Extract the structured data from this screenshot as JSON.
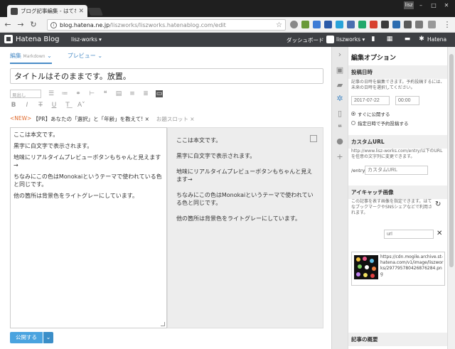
{
  "browser": {
    "tab_title": "ブログ記事編集 - はてなブロ",
    "url_host": "blog.hatena.ne.jp",
    "url_path": "/liszworks/liszworks.hatenablog.com/edit",
    "user_chip": "lisz"
  },
  "header": {
    "logo_text": "Hatena Blog",
    "blog_name": "lisz-works ▾",
    "dashboard": "ダッシュボード",
    "user": "liszworks ▾",
    "hatena": "Hatena"
  },
  "editor": {
    "tab_edit": "編集",
    "tab_edit_mode": "Markdown",
    "tab_preview": "プレビュー",
    "title": "タイトルはそのままです。放置。",
    "heading_select": "見出し",
    "tag_new": "<NEW>",
    "tag_pr": "【PR】あなたの「選択」と「年齢」を教えて! ×",
    "tag_slot": "お題スロット ×",
    "body_lines": [
      "ここは本文です。",
      "黒字に白文字で表示されます。",
      "地味にリアルタイムプレビューボタンもちゃんと見えます→",
      "ちなみにこの色はMonokaiというテーマで使われている色と同じです。",
      "他の箇所は背景色をライトグレーにしています。"
    ],
    "preview_lines": [
      "ここは本文です。",
      "黒字に白文字で表示されます。",
      "地味にリアルタイムプレビューボタンもちゃんと見えます→",
      "ちなみにこの色はMonokaiというテーマで使われている色と同じです。",
      "他の箇所は背景色をライトグレーにしています。"
    ],
    "publish": "公開する"
  },
  "panel": {
    "title": "編集オプション",
    "post_date": {
      "heading": "投稿日時",
      "desc": "記事の日時を編集できます。予約投稿するには、未来の日時を選択してください。",
      "date": "2017-07-22",
      "time": "00:00",
      "opt_now": "すぐに公開する",
      "opt_schedule": "指定日時で予約投稿する"
    },
    "custom_url": {
      "heading": "カスタムURL",
      "desc": "http://www.lisz-works.com/entry/以下のURLを任意の文字列に変更できます。",
      "prefix": "/entry/",
      "placeholder": "カスタムURL"
    },
    "eyecatch": {
      "heading": "アイキャッチ画像",
      "desc": "この記事を表す画像を指定できます。はてなブックマークやSNSシェアなどで利用されます。",
      "url_placeholder": "url",
      "image_url": "https://cdn.mogile.archive.st-hatena.com/v1/image/liszworks/297795780426876284.png"
    },
    "summary": {
      "heading": "記事の概要"
    }
  },
  "colors": {
    "accent": "#4a8cc7",
    "publish": "#4aa3df",
    "header_bg": "#3d3f43"
  }
}
